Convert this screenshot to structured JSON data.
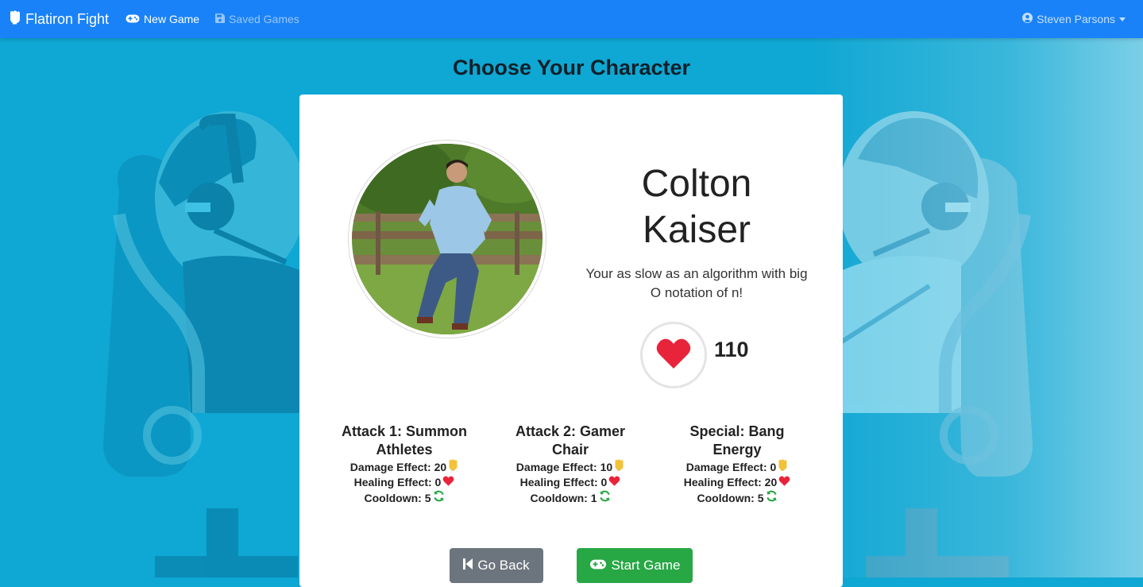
{
  "nav": {
    "brand": "Flatiron Fight",
    "new_game": "New Game",
    "saved_games": "Saved Games",
    "user": "Steven Parsons"
  },
  "page": {
    "title": "Choose Your Character"
  },
  "character": {
    "name": "Colton Kaiser",
    "quote": "Your as slow as an algorithm with big O notation of n!",
    "health": "110"
  },
  "attacks": [
    {
      "name": "Attack 1: Summon Athletes",
      "damage": "Damage Effect: 20",
      "healing": "Healing Effect: 0",
      "cooldown": "Cooldown: 5"
    },
    {
      "name": "Attack 2: Gamer Chair",
      "damage": "Damage Effect: 10",
      "healing": "Healing Effect: 0",
      "cooldown": "Cooldown: 1"
    },
    {
      "name": "Special: Bang Energy",
      "damage": "Damage Effect: 0",
      "healing": "Healing Effect: 20",
      "cooldown": "Cooldown: 5"
    }
  ],
  "buttons": {
    "back": "Go Back",
    "start": "Start Game"
  },
  "colors": {
    "navbar": "#1a82f8",
    "background": "#0fa7d3",
    "heart": "#e8243a",
    "fist": "#f2c23a",
    "cooldown": "#28a745",
    "back_button": "#6c757d",
    "start_button": "#28a745"
  },
  "icons": {
    "brand": "fist-icon",
    "new_game": "gamepad-icon",
    "saved_games": "save-icon",
    "user": "user-circle-icon",
    "health": "heart-icon",
    "damage": "fist-icon",
    "healing": "heart-icon",
    "cooldown": "refresh-icon",
    "back": "step-back-icon",
    "start": "gamepad-icon"
  }
}
